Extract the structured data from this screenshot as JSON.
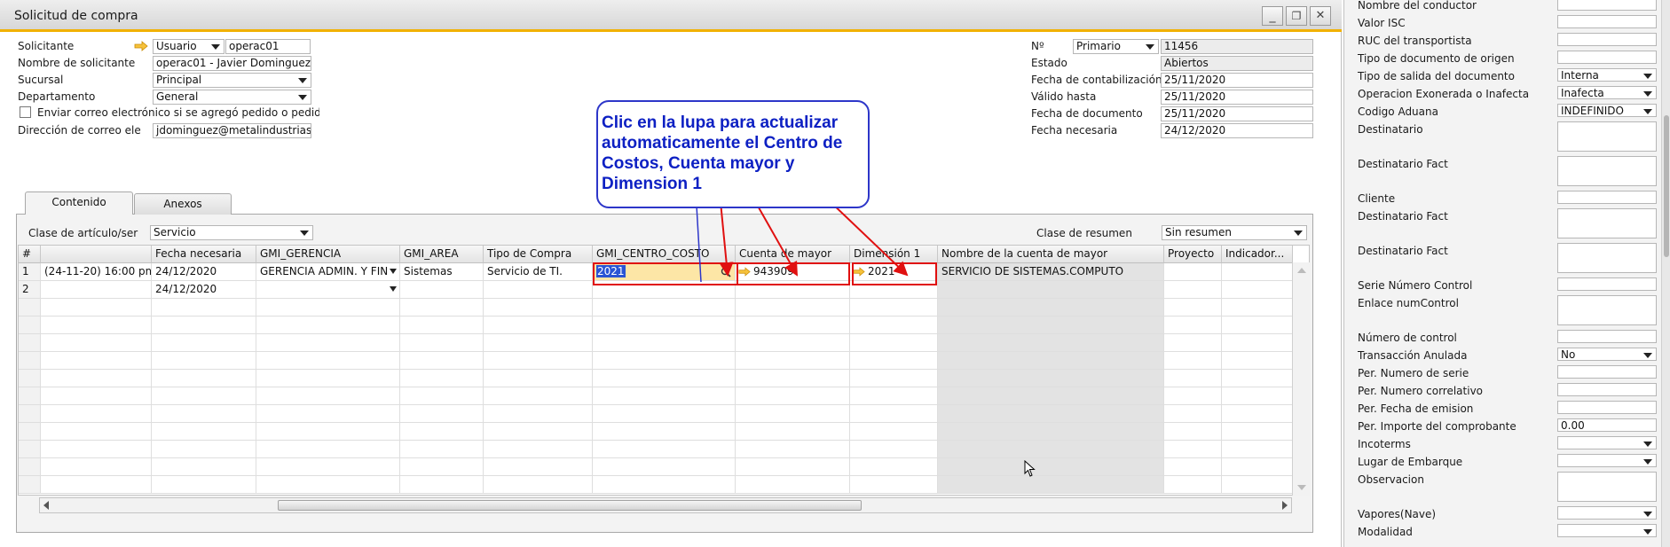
{
  "window": {
    "title": "Solicitud de compra",
    "minimize": "_",
    "restore": "❐",
    "close": "✕"
  },
  "header_left": {
    "solicitante_label": "Solicitante",
    "solicitante_type": "Usuario",
    "solicitante_value": "operac01",
    "nombre_label": "Nombre de solicitante",
    "nombre_value": "operac01 - Javier Dominguez",
    "sucursal_label": "Sucursal",
    "sucursal_value": "Principal",
    "departamento_label": "Departamento",
    "departamento_value": "General",
    "email_check_label": "Enviar correo electrónico si se agregó pedido o pedido e",
    "email_label": "Dirección de correo ele",
    "email_value": "jdominguez@metalindustrias.co"
  },
  "header_right": {
    "no_label": "Nº",
    "no_series": "Primario",
    "no_value": "11456",
    "estado_label": "Estado",
    "estado_value": "Abiertos",
    "fecha_contab_label": "Fecha de contabilización",
    "fecha_contab_value": "25/11/2020",
    "valido_label": "Válido hasta",
    "valido_value": "25/11/2020",
    "fecha_doc_label": "Fecha de documento",
    "fecha_doc_value": "25/11/2020",
    "fecha_nec_label": "Fecha necesaria",
    "fecha_nec_value": "24/12/2020"
  },
  "tabs": {
    "contenido": "Contenido",
    "anexos": "Anexos"
  },
  "content": {
    "clase_articulo_label": "Clase de artículo/ser",
    "clase_articulo_value": "Servicio",
    "clase_resumen_label": "Clase de resumen",
    "clase_resumen_value": "Sin resumen"
  },
  "grid": {
    "columns": [
      "#",
      "",
      "Fecha necesaria",
      "GMI_GERENCIA",
      "GMI_AREA",
      "Tipo de Compra",
      "GMI_CENTRO_COSTO",
      "Cuenta de mayor",
      "Dimensión 1",
      "Nombre de la cuenta de mayor",
      "Proyecto",
      "Indicador..."
    ],
    "rows": [
      [
        "1",
        "(24-11-20) 16:00 pm",
        "24/12/2020",
        "GERENCIA ADMIN. Y FIN",
        "Sistemas",
        "Servicio de TI.",
        "2021",
        "943909",
        "2021",
        "SERVICIO DE SISTEMAS.COMPUTO",
        "",
        ""
      ],
      [
        "2",
        "",
        "24/12/2020",
        "",
        "",
        "",
        "",
        "",
        "",
        "",
        "",
        ""
      ]
    ]
  },
  "callout": {
    "text": "Clic en la lupa para actualizar automaticamente el Centro de Costos, Cuenta mayor y Dimension 1"
  },
  "side_panel": {
    "fields": [
      {
        "label": "Nombre del conductor",
        "value": "",
        "kind": "text"
      },
      {
        "label": "Valor ISC",
        "value": "",
        "kind": "text"
      },
      {
        "label": "RUC del transportista",
        "value": "",
        "kind": "text"
      },
      {
        "label": "Tipo de documento de origen",
        "value": "",
        "kind": "text"
      },
      {
        "label": "Tipo de salida del documento",
        "value": "Interna",
        "kind": "select"
      },
      {
        "label": "Operacion Exonerada o Inafecta",
        "value": "Inafecta",
        "kind": "select"
      },
      {
        "label": "Codigo Aduana",
        "value": "INDEFINIDO",
        "kind": "select"
      },
      {
        "label": "Destinatario",
        "value": "",
        "kind": "textarea"
      },
      {
        "label": "Destinatario Fact",
        "value": "",
        "kind": "textarea"
      },
      {
        "label": "Cliente",
        "value": "",
        "kind": "text"
      },
      {
        "label": "Destinatario Fact",
        "value": "",
        "kind": "textarea"
      },
      {
        "label": "Destinatario Fact",
        "value": "",
        "kind": "textarea"
      },
      {
        "label": "Serie Número Control",
        "value": "",
        "kind": "text"
      },
      {
        "label": "Enlace numControl",
        "value": "",
        "kind": "textarea"
      },
      {
        "label": "Número de control",
        "value": "",
        "kind": "text"
      },
      {
        "label": "Transacción Anulada",
        "value": "No",
        "kind": "select"
      },
      {
        "label": "Per. Numero de serie",
        "value": "",
        "kind": "text"
      },
      {
        "label": "Per. Numero correlativo",
        "value": "",
        "kind": "text"
      },
      {
        "label": "Per. Fecha de emision",
        "value": "",
        "kind": "text"
      },
      {
        "label": "Per. Importe del comprobante",
        "value": "0.00",
        "kind": "text"
      },
      {
        "label": "Incoterms",
        "value": "",
        "kind": "select"
      },
      {
        "label": "Lugar de Embarque",
        "value": "",
        "kind": "select"
      },
      {
        "label": "Observacion",
        "value": "",
        "kind": "textarea"
      },
      {
        "label": "Vapores(Nave)",
        "value": "",
        "kind": "select"
      },
      {
        "label": "Modalidad",
        "value": "",
        "kind": "select"
      }
    ]
  },
  "colors": {
    "accent": "#f1b100",
    "callout_text": "#0d20c3",
    "highlight_box": "#e01010",
    "selected_cell": "#2a55d4",
    "active_cell_bg": "#fde6a6"
  }
}
